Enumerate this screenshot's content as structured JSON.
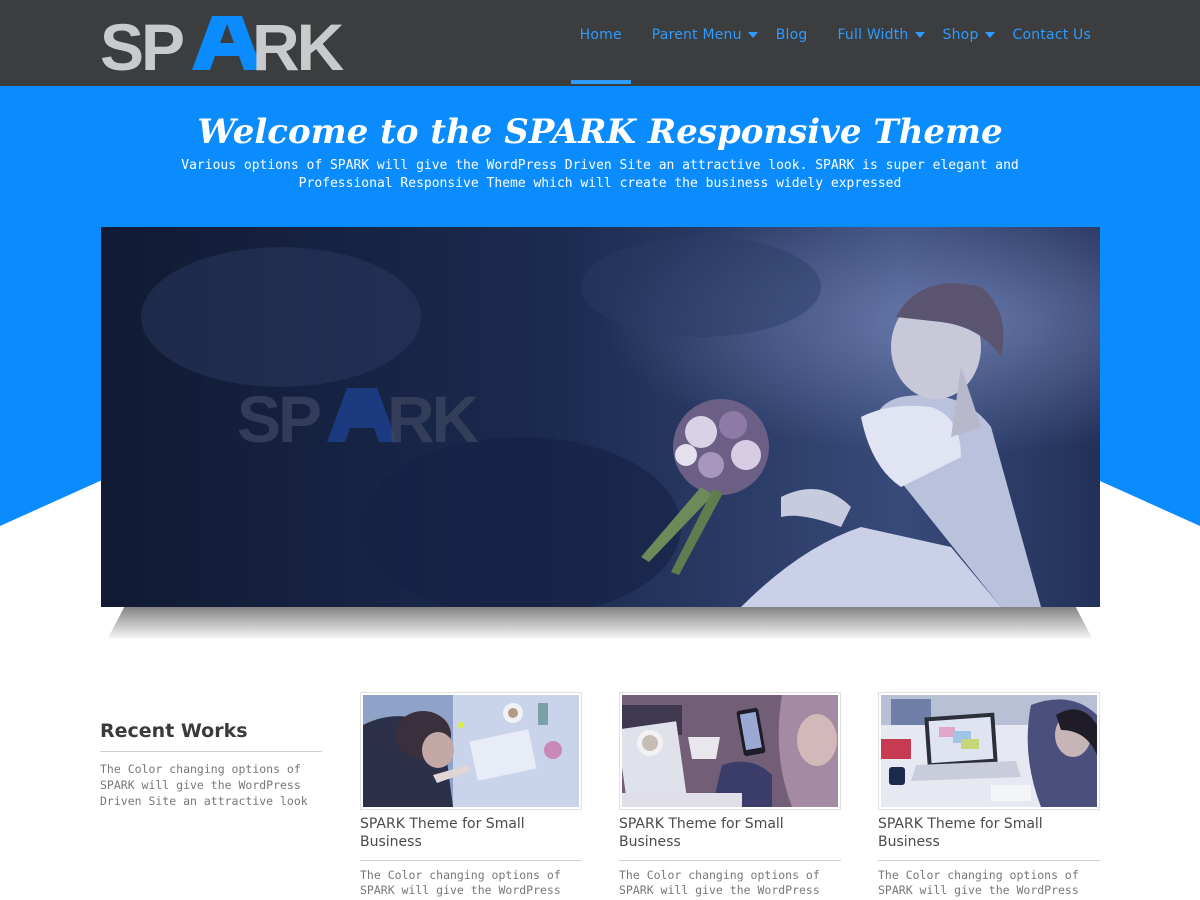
{
  "brand": {
    "logo_text": "SPARK",
    "colors": {
      "accent": "#0a8cff",
      "header_bg": "#3b3d3f",
      "nav_link": "#2e9bff"
    }
  },
  "nav": {
    "items": [
      {
        "label": "Home",
        "active": true,
        "has_dropdown": false
      },
      {
        "label": "Parent Menu",
        "active": false,
        "has_dropdown": true
      },
      {
        "label": "Blog",
        "active": false,
        "has_dropdown": false
      },
      {
        "label": "Full Width",
        "active": false,
        "has_dropdown": true
      },
      {
        "label": "Shop",
        "active": false,
        "has_dropdown": true
      },
      {
        "label": "Contact Us",
        "active": false,
        "has_dropdown": false
      }
    ]
  },
  "hero": {
    "title": "Welcome to the SPARK Responsive Theme",
    "description": "Various options of SPARK will give the WordPress Driven Site an attractive look. SPARK is super elegant and Professional Responsive Theme which will create the business widely expressed"
  },
  "slider": {
    "watermark": "SPARK",
    "image": "bride-with-bouquet"
  },
  "recent_works": {
    "title": "Recent Works",
    "description": "The Color changing options of SPARK will give the WordPress Driven Site an attractive look"
  },
  "cards": [
    {
      "title": "SPARK Theme for Small Business",
      "excerpt": "The Color changing options of SPARK will give the WordPress Driven Site an",
      "image": "woman-writing-at-desk"
    },
    {
      "title": "SPARK Theme for Small Business",
      "excerpt": "The Color changing options of SPARK will give the WordPress Driven Site an",
      "image": "coffee-and-smartphone"
    },
    {
      "title": "SPARK Theme for Small Business",
      "excerpt": "The Color changing options of SPARK will give the WordPress Driven Site an",
      "image": "laptop-meeting"
    }
  ]
}
